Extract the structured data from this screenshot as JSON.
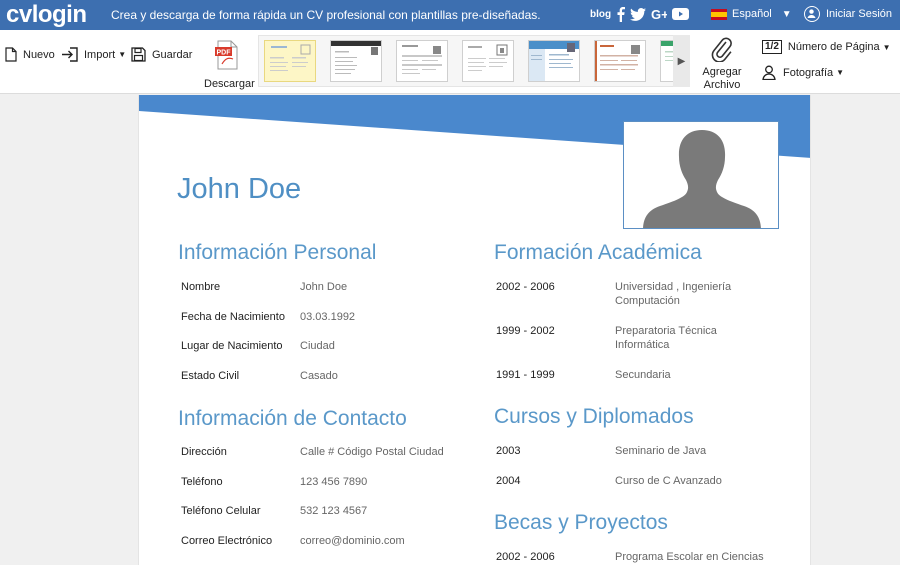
{
  "topbar": {
    "logo": "cvlogin",
    "tagline": "Crea y descarga de forma rápida un CV profesional con plantillas pre-diseñadas.",
    "blog": "blog",
    "social": [
      "facebook-icon",
      "twitter-icon",
      "google-plus-icon",
      "youtube-icon"
    ],
    "language": "Español",
    "login": "Iniciar Sesión",
    "bar_color": "#3d6fb0"
  },
  "toolbar": {
    "new_label": "Nuevo",
    "import_label": "Import",
    "save_label": "Guardar",
    "download_label": "Descargar",
    "attach_label": "Agregar Archivo",
    "page_icon": "1/2",
    "page_number_label": "Número de Página",
    "photo_label": "Fotografía"
  },
  "cv": {
    "name": "John Doe",
    "accent_color": "#4a88cd",
    "personal": {
      "title": "Información Personal",
      "rows": [
        {
          "k": "Nombre",
          "v": "John Doe"
        },
        {
          "k": "Fecha de Nacimiento",
          "v": "03.03.1992"
        },
        {
          "k": "Lugar de Nacimiento",
          "v": "Ciudad"
        },
        {
          "k": "Estado Civil",
          "v": "Casado"
        }
      ]
    },
    "contact": {
      "title": "Información de Contacto",
      "rows": [
        {
          "k": "Dirección",
          "v": "Calle # Código Postal Ciudad"
        },
        {
          "k": "Teléfono",
          "v": "123 456 7890"
        },
        {
          "k": "Teléfono Celular",
          "v": "532 123 4567"
        },
        {
          "k": "Correo Electrónico",
          "v": "correo@dominio.com"
        }
      ]
    },
    "education": {
      "title": "Formación Académica",
      "rows": [
        {
          "k": "2002 - 2006",
          "v": "Universidad , Ingeniería Computación"
        },
        {
          "k": "1999 - 2002",
          "v": "Preparatoria Técnica Informática"
        },
        {
          "k": "1991 - 1999",
          "v": "Secundaria"
        }
      ]
    },
    "courses": {
      "title": "Cursos y Diplomados",
      "rows": [
        {
          "k": "2003",
          "v": "Seminario de Java"
        },
        {
          "k": "2004",
          "v": "Curso de C Avanzado"
        }
      ]
    },
    "projects": {
      "title": "Becas y Proyectos",
      "rows": [
        {
          "k": "2002 - 2006",
          "v": "Programa Escolar en Ciencias"
        }
      ]
    }
  }
}
